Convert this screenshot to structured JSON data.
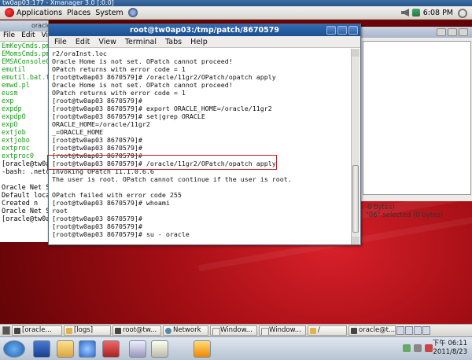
{
  "xmanager": {
    "title": "tw0ap03:177 - Xmanager 3.0 [:0.0]"
  },
  "top_panel": {
    "applications": "Applications",
    "places": "Places",
    "system": "System",
    "clock": "6:08 PM"
  },
  "bg_terminal": {
    "title": "oracle@tw0ap03:/oracle/11gr2/bin",
    "menu": [
      "File",
      "Edit",
      "View"
    ],
    "lines": [
      {
        "text": "EmKeyCmds.pm",
        "color": "grn"
      },
      {
        "text": "EMomsCmds.pm",
        "color": "grn"
      },
      {
        "text": "EMSAConsoleCo",
        "color": "grn"
      },
      {
        "text": "emutil",
        "color": "grn"
      },
      {
        "text": "emutil.bat.te",
        "color": "grn"
      },
      {
        "text": "emwd.pl",
        "color": "grn"
      },
      {
        "text": "eusm",
        "color": "grn"
      },
      {
        "text": "exp",
        "color": "grn"
      },
      {
        "text": "expdp",
        "color": "grn"
      },
      {
        "text": "expdpO",
        "color": "grn"
      },
      {
        "text": "expO",
        "color": "grn"
      },
      {
        "text": "extjob",
        "color": "grn"
      },
      {
        "text": "extjobo",
        "color": "grn"
      },
      {
        "text": "extproc",
        "color": "grn"
      },
      {
        "text": "extproc0",
        "color": "grn"
      },
      {
        "text": "[oracle@tw0a",
        "color": ""
      },
      {
        "text": "-bash: .netca",
        "color": ""
      },
      {
        "text": "",
        "color": ""
      },
      {
        "text": "Oracle Net Se",
        "color": ""
      },
      {
        "text": "Default local",
        "color": ""
      },
      {
        "text": "   Created n",
        "color": ""
      },
      {
        "text": "Oracle Net Se",
        "color": ""
      },
      {
        "text": "[oracle@tw0a",
        "color": ""
      }
    ]
  },
  "bg_dialog": {
    "bytes_text": "0 bytes)",
    "selected_text": "\"06\" selected (0 bytes)"
  },
  "terminal": {
    "title": "root@tw0ap03:/tmp/patch/8670579",
    "menu": [
      "File",
      "Edit",
      "View",
      "Terminal",
      "Tabs",
      "Help"
    ],
    "lines": [
      "r2/oraInst.loc",
      "Oracle Home is not set. OPatch cannot proceed!",
      "OPatch returns with error code = 1",
      "[root@tw0ap03 8670579]# /oracle/11gr2/OPatch/opatch apply",
      "Oracle Home is not set. OPatch cannot proceed!",
      "OPatch returns with error code = 1",
      "[root@tw0ap03 8670579]#",
      "[root@tw0ap03 8670579]# export ORACLE_HOME=/oracle/11gr2",
      "[root@tw0ap03 8670579]# set|grep ORACLE",
      "ORACLE_HOME=/oracle/11gr2",
      "_=ORACLE_HOME",
      "[root@tw0ap03 8670579]#",
      "[root@tw0ap03 8670579]#",
      "[root@tw0ap03 8670579]#",
      "[root@tw0ap03 8670579]# /oracle/11gr2/OPatch/opatch apply",
      "Invoking OPatch 11.1.0.6.6",
      "The user is root. OPatch cannot continue if the user is root.",
      "",
      "OPatch failed with error code 255",
      "[root@tw0ap03 8670579]# whoami",
      "root",
      "[root@tw0ap03 8670579]#",
      "[root@tw0ap03 8670579]#",
      "[root@tw0ap03 8670579]# su - oracle"
    ]
  },
  "bottom_panel": {
    "tasks": [
      {
        "label": "[oracle...",
        "kind": "term"
      },
      {
        "label": "[logs]",
        "kind": "folder"
      },
      {
        "label": "root@tw...",
        "kind": "term"
      },
      {
        "label": "Network",
        "kind": "net"
      },
      {
        "label": "Window...",
        "kind": "win"
      },
      {
        "label": "Window...",
        "kind": "win"
      },
      {
        "label": "/",
        "kind": "folder"
      },
      {
        "label": "oracle@t...",
        "kind": "term"
      }
    ]
  },
  "windows_taskbar": {
    "clock_time": "下午 06:11",
    "clock_date": "2011/8/23"
  }
}
